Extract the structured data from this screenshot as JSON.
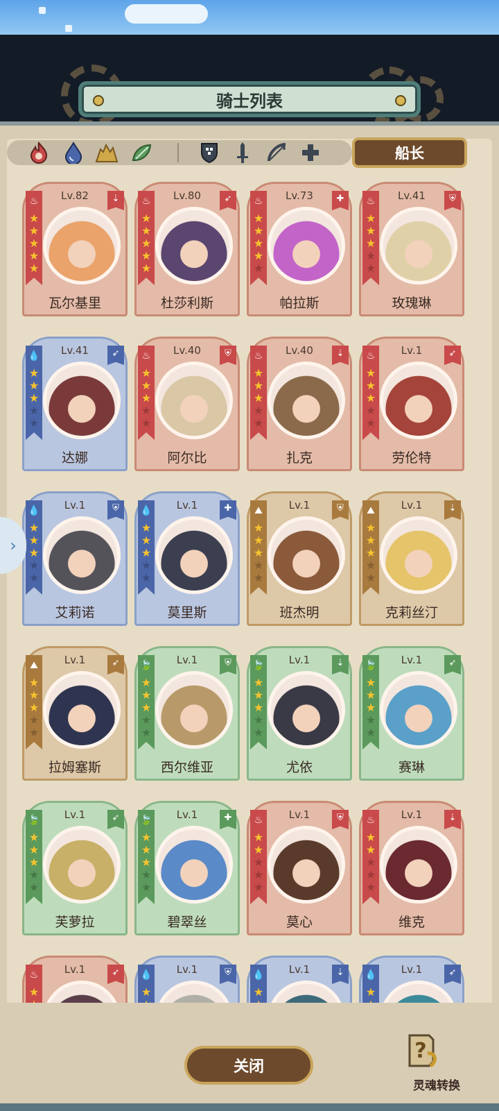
{
  "header": {
    "title": "骑士列表"
  },
  "filters": {
    "elements": [
      "fire-element-icon",
      "water-element-icon",
      "earth-element-icon",
      "wind-element-icon"
    ],
    "roles": [
      "shield-class-icon",
      "sword-class-icon",
      "bow-class-icon",
      "healer-class-icon"
    ]
  },
  "captain_button": {
    "label": "船长"
  },
  "colors": {
    "fire": "#c94a4a",
    "water": "#4b66a8",
    "earth": "#a97a3e",
    "wind": "#5b9a5c",
    "accent": "#c9a55c"
  },
  "knights": [
    {
      "name": "瓦尔基里",
      "level": "Lv.82",
      "element": "fire",
      "role": "sword",
      "stars": 5
    },
    {
      "name": "杜莎利斯",
      "level": "Lv.80",
      "element": "fire",
      "role": "bow",
      "stars": 5
    },
    {
      "name": "帕拉斯",
      "level": "Lv.73",
      "element": "fire",
      "role": "healer",
      "stars": 4
    },
    {
      "name": "玫瑰琳",
      "level": "Lv.41",
      "element": "fire",
      "role": "shield",
      "stars": 3
    },
    {
      "name": "达娜",
      "level": "Lv.41",
      "element": "water",
      "role": "bow",
      "stars": 3
    },
    {
      "name": "阿尔比",
      "level": "Lv.40",
      "element": "fire",
      "role": "shield",
      "stars": 3
    },
    {
      "name": "扎克",
      "level": "Lv.40",
      "element": "fire",
      "role": "sword",
      "stars": 3
    },
    {
      "name": "劳伦特",
      "level": "Lv.1",
      "element": "fire",
      "role": "bow",
      "stars": 3
    },
    {
      "name": "艾莉诺",
      "level": "Lv.1",
      "element": "water",
      "role": "shield",
      "stars": 3
    },
    {
      "name": "莫里斯",
      "level": "Lv.1",
      "element": "water",
      "role": "healer",
      "stars": 3
    },
    {
      "name": "班杰明",
      "level": "Lv.1",
      "element": "earth",
      "role": "shield",
      "stars": 3
    },
    {
      "name": "克莉丝汀",
      "level": "Lv.1",
      "element": "earth",
      "role": "sword",
      "stars": 3
    },
    {
      "name": "拉姆塞斯",
      "level": "Lv.1",
      "element": "earth",
      "role": "bow",
      "stars": 3
    },
    {
      "name": "西尔维亚",
      "level": "Lv.1",
      "element": "wind",
      "role": "shield",
      "stars": 3
    },
    {
      "name": "尤依",
      "level": "Lv.1",
      "element": "wind",
      "role": "sword",
      "stars": 3
    },
    {
      "name": "赛琳",
      "level": "Lv.1",
      "element": "wind",
      "role": "bow",
      "stars": 3
    },
    {
      "name": "芙萝拉",
      "level": "Lv.1",
      "element": "wind",
      "role": "bow",
      "stars": 3
    },
    {
      "name": "碧翠丝",
      "level": "Lv.1",
      "element": "wind",
      "role": "healer",
      "stars": 3
    },
    {
      "name": "莫心",
      "level": "Lv.1",
      "element": "fire",
      "role": "shield",
      "stars": 2
    },
    {
      "name": "维克",
      "level": "Lv.1",
      "element": "fire",
      "role": "sword",
      "stars": 2
    },
    {
      "name": "",
      "level": "Lv.1",
      "element": "fire",
      "role": "bow",
      "stars": 2
    },
    {
      "name": "",
      "level": "Lv.1",
      "element": "water",
      "role": "shield",
      "stars": 2
    },
    {
      "name": "",
      "level": "Lv.1",
      "element": "water",
      "role": "sword",
      "stars": 2
    },
    {
      "name": "",
      "level": "Lv.1",
      "element": "water",
      "role": "bow",
      "stars": 2
    }
  ],
  "close_button": {
    "label": "关闭"
  },
  "soul_convert": {
    "label": "灵魂转换"
  }
}
